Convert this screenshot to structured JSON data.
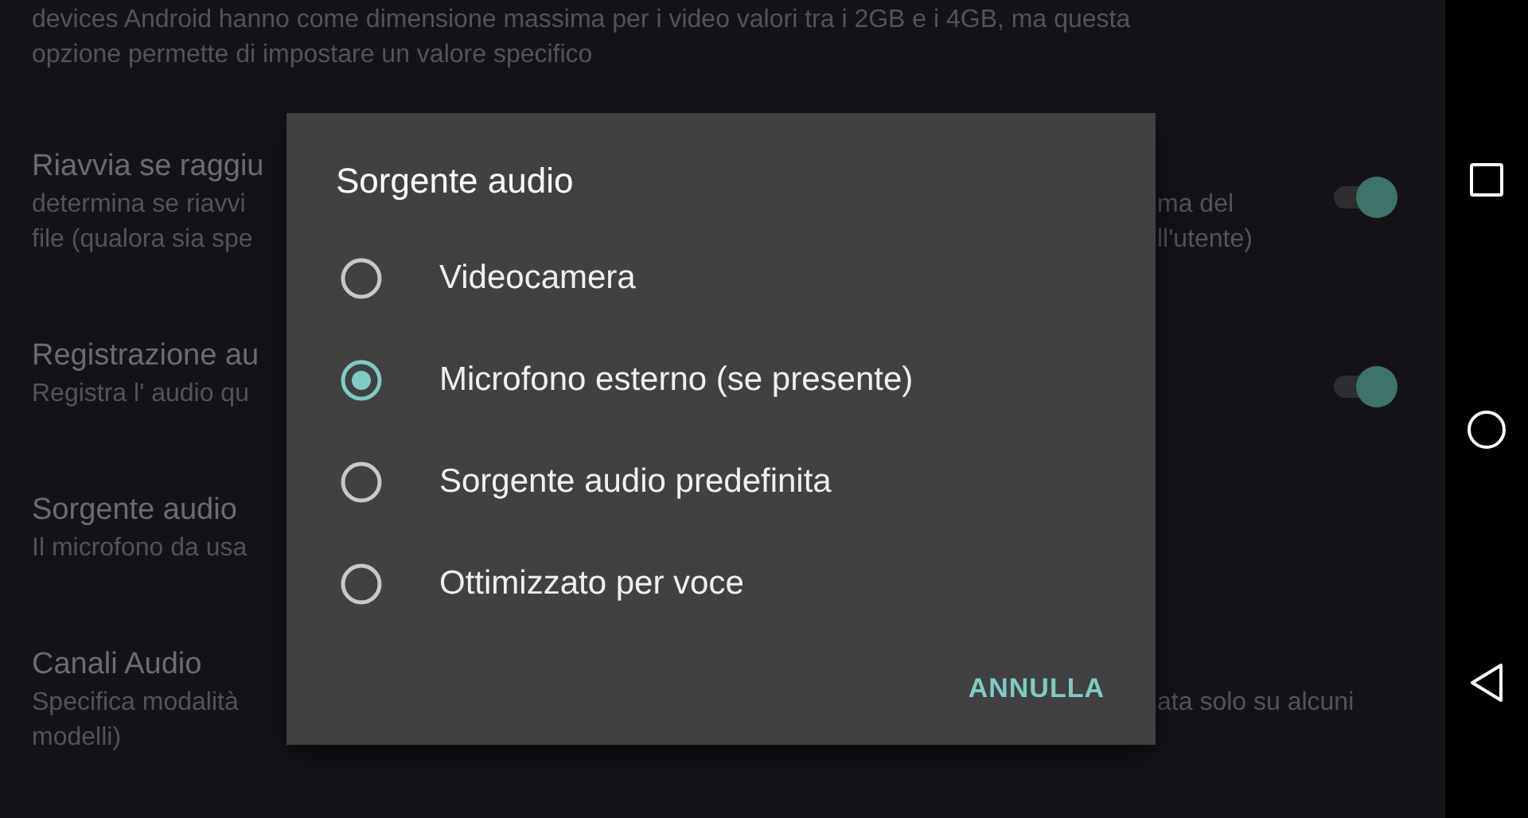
{
  "settings": [
    {
      "description": [
        {
          "left": "devices Android hanno come dimensione massima per i video valori tra i 2GB e i 4GB, ma questa"
        },
        {
          "left": "opzione permette di impostare un valore specifico"
        }
      ]
    },
    {
      "title": "Riavvia se raggiu",
      "description": [
        {
          "left": "determina se riavvi",
          "right": "ma del"
        },
        {
          "left": "file (qualora sia spe",
          "right": "ll'utente)"
        }
      ],
      "toggle": {
        "on": true
      }
    },
    {
      "title": "Registrazione au",
      "description": [
        {
          "left": "Registra l' audio qu"
        }
      ],
      "toggle": {
        "on": true
      }
    },
    {
      "title": "Sorgente audio",
      "description": [
        {
          "left": "Il microfono da usa"
        }
      ]
    },
    {
      "title": "Canali Audio",
      "description": [
        {
          "left": "Specifica modalità",
          "right": "ata solo su alcuni"
        },
        {
          "left": "modelli)"
        }
      ]
    }
  ],
  "dialog": {
    "title": "Sorgente audio",
    "options": [
      {
        "label": "Videocamera",
        "selected": false
      },
      {
        "label": "Microfono esterno (se presente)",
        "selected": true
      },
      {
        "label": "Sorgente audio predefinita",
        "selected": false
      },
      {
        "label": "Ottimizzato per voce",
        "selected": false
      }
    ],
    "button": "ANNULLA"
  },
  "nav_bar": [
    {
      "kind": "recents"
    },
    {
      "kind": "home"
    },
    {
      "kind": "back"
    }
  ]
}
